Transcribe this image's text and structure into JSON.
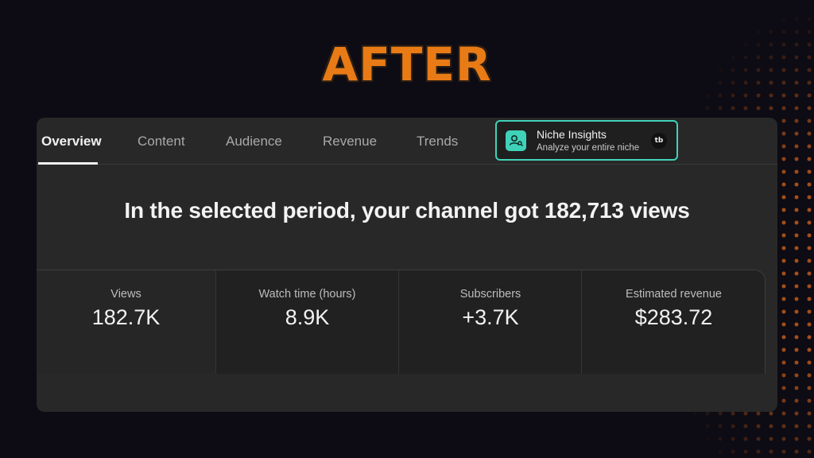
{
  "headline": "AFTER",
  "tabs": [
    {
      "label": "Overview"
    },
    {
      "label": "Content"
    },
    {
      "label": "Audience"
    },
    {
      "label": "Revenue"
    },
    {
      "label": "Trends"
    }
  ],
  "active_tab": "Overview",
  "niche_insights": {
    "title": "Niche Insights",
    "subtitle": "Analyze your entire niche",
    "badge": "tb",
    "icon": "user-search-icon",
    "accent": "#3fd2b8"
  },
  "summary": "In the selected period, your channel got 182,713 views",
  "metrics": [
    {
      "label": "Views",
      "value": "182.7K"
    },
    {
      "label": "Watch time (hours)",
      "value": "8.9K"
    },
    {
      "label": "Subscribers",
      "value": "+3.7K"
    },
    {
      "label": "Estimated revenue",
      "value": "$283.72"
    }
  ],
  "colors": {
    "headline": "#e87b16",
    "background": "#0d0b13",
    "panel": "#282828"
  }
}
